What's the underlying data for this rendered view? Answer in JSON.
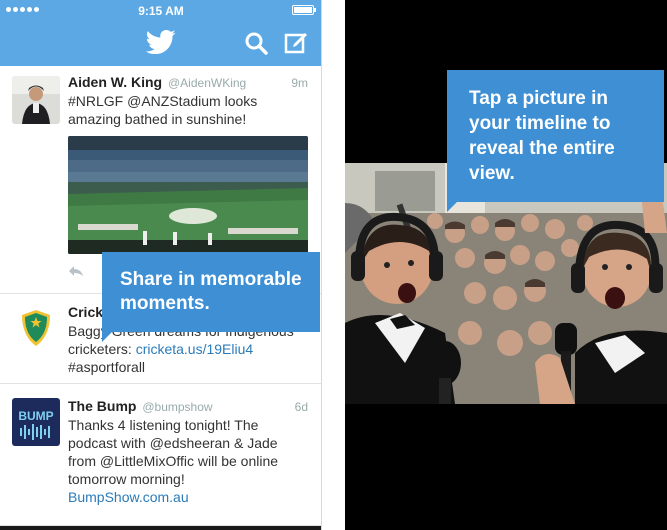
{
  "status_bar": {
    "time": "9:15 AM"
  },
  "nav": {
    "logo": "twitter-bird-icon",
    "search_icon": "search-icon",
    "compose_icon": "compose-icon"
  },
  "tweets": [
    {
      "name": "Aiden W. King",
      "handle": "@AidenWKing",
      "time": "9m",
      "text": "#NRLGF @ANZStadium looks amazing bathed in sunshine!"
    },
    {
      "name": "Crick",
      "text_line1": "Baggy Green dreams for Indigenous",
      "text_line2_prefix": "cricketers: ",
      "link": "cricketa.us/19Eliu4",
      "text_line3": "#asportforall"
    },
    {
      "name": "The Bump",
      "handle": "@bumpshow",
      "time": "6d",
      "text": "Thanks 4 listening tonight! The podcast with @edsheeran & Jade from @LittleMixOffic will be online tomorrow morning!",
      "link": "BumpShow.com.au",
      "avatar_text": "BUMP"
    }
  ],
  "tooltips": {
    "share": "Share in memorable moments.",
    "tap": "Tap a picture in your timeline to reveal the entire view."
  },
  "colors": {
    "twitter_blue": "#5ba8e4",
    "tooltip_blue": "#3e8fd4",
    "link_blue": "#2b7bb9"
  }
}
